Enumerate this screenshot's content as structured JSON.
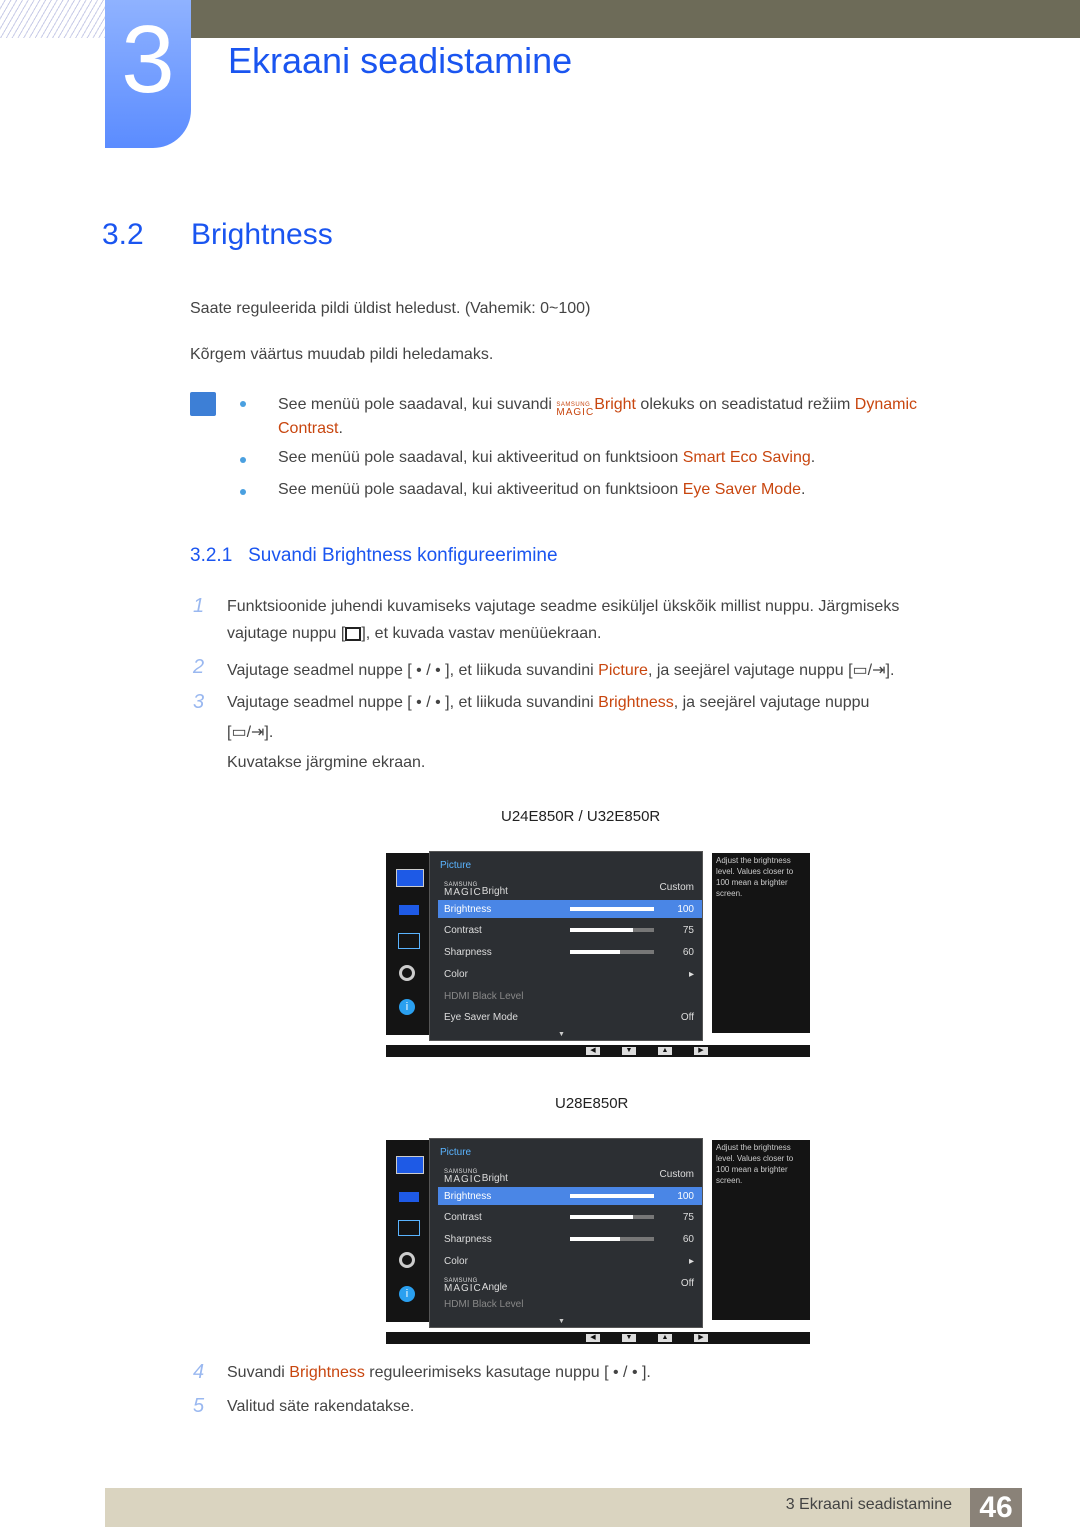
{
  "header": {
    "chapter_number": "3",
    "chapter_title": "Ekraani seadistamine"
  },
  "section": {
    "number": "3.2",
    "title": "Brightness"
  },
  "intro": [
    "Saate reguleerida pildi üldist heledust. (Vahemik: 0~100)",
    "Kõrgem väärtus muudab pildi heledamaks."
  ],
  "notes": [
    {
      "pre": "See menüü pole saadaval, kui suvandi ",
      "magic_top": "SAMSUNG",
      "magic_bottom": "MAGIC",
      "magic_word": "Bright",
      "mid": " olekuks on seadistatud režiim ",
      "hl": "Dynamic Contrast",
      "post": "."
    },
    {
      "pre": "See menüü pole saadaval, kui aktiveeritud on funktsioon ",
      "hl": "Smart Eco Saving",
      "post": "."
    },
    {
      "pre": "See menüü pole saadaval, kui aktiveeritud on funktsioon ",
      "hl": "Eye Saver Mode",
      "post": "."
    }
  ],
  "subsection": {
    "number": "3.2.1",
    "title": "Suvandi Brightness konfigureerimine"
  },
  "steps": [
    {
      "n": "1",
      "line1": "Funktsioonide juhendi kuvamiseks vajutage seadme esiküljel ükskõik millist nuppu. Järgmiseks",
      "line2a": "vajutage nuppu [",
      "line2b": "], et kuvada vastav menüüekraan."
    },
    {
      "n": "2",
      "pre": "Vajutage seadmel nuppe [ • / • ], et liikuda suvandini ",
      "hl": "Picture",
      "post": ", ja seejärel vajutage nuppu [",
      "end": "]."
    },
    {
      "n": "3",
      "pre": "Vajutage seadmel nuppe [ • / • ], et liikuda suvandini ",
      "hl": "Brightness",
      "post": ", ja seejärel vajutage nuppu",
      "line2a": "[",
      "line2b": "].",
      "after": "Kuvatakse järgmine ekraan."
    },
    {
      "n": "4",
      "pre": "Suvandi ",
      "hl": "Brightness",
      "post": " reguleerimiseks kasutage nuppu [ • / • ]."
    },
    {
      "n": "5",
      "text": "Valitud säte rakendatakse."
    }
  ],
  "osd_screens": [
    {
      "model": "U24E850R / U32E850R",
      "menu_title": "Picture",
      "rows": [
        {
          "label": "Bright",
          "magic": true,
          "value": "Custom"
        },
        {
          "label": "Brightness",
          "value": "100",
          "level": 100,
          "selected": true
        },
        {
          "label": "Contrast",
          "value": "75",
          "level": 75
        },
        {
          "label": "Sharpness",
          "value": "60",
          "level": 60
        },
        {
          "label": "Color",
          "value": "▸"
        },
        {
          "label": "HDMI Black Level",
          "value": "",
          "dim": true
        },
        {
          "label": "Eye Saver Mode",
          "value": "Off"
        }
      ],
      "help": "Adjust the brightness level. Values closer to 100 mean a brighter screen."
    },
    {
      "model": "U28E850R",
      "menu_title": "Picture",
      "rows": [
        {
          "label": "Bright",
          "magic": true,
          "value": "Custom"
        },
        {
          "label": "Brightness",
          "value": "100",
          "level": 100,
          "selected": true
        },
        {
          "label": "Contrast",
          "value": "75",
          "level": 75
        },
        {
          "label": "Sharpness",
          "value": "60",
          "level": 60
        },
        {
          "label": "Color",
          "value": "▸"
        },
        {
          "label": "Angle",
          "magic": true,
          "value": "Off"
        },
        {
          "label": "HDMI Black Level",
          "value": "",
          "dim": true
        }
      ],
      "help": "Adjust the brightness level. Values closer to 100 mean a brighter screen."
    }
  ],
  "osd_common": {
    "magic_top": "SAMSUNG",
    "magic_bottom": "MAGIC",
    "nav_buttons": [
      "◀",
      "▼",
      "▲",
      "▶"
    ]
  },
  "footer": {
    "text": "3 Ekraani seadistamine",
    "page": "46"
  }
}
